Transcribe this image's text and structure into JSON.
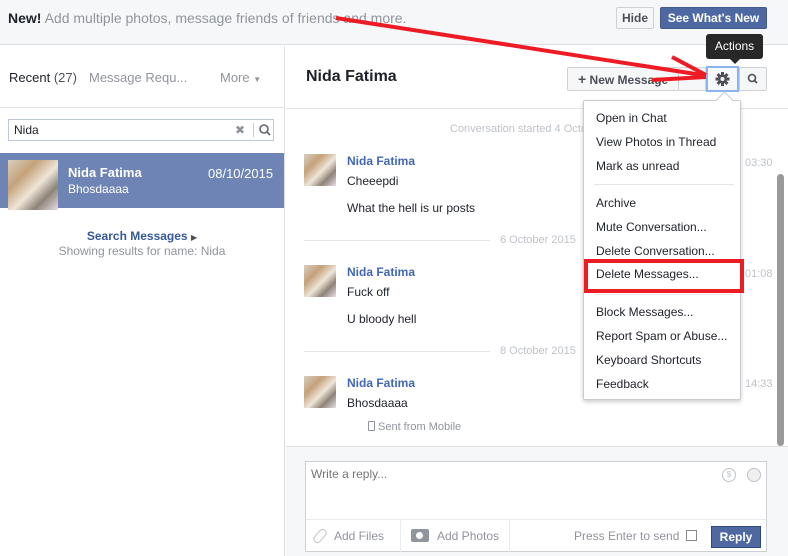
{
  "banner": {
    "new_label": "New!",
    "message": "Add multiple photos, message friends of friends and more.",
    "hide_label": "Hide",
    "see_whats_new_label": "See What's New"
  },
  "sidebar": {
    "recent_label": "Recent",
    "recent_count": "(27)",
    "requests_label": "Message Requ...",
    "more_label": "More",
    "search": {
      "value": "Nida",
      "placeholder": ""
    },
    "conversations": [
      {
        "name": "Nida Fatima",
        "snippet": "Bhosdaaaa",
        "date": "08/10/2015",
        "selected": true
      }
    ],
    "search_messages_label": "Search Messages",
    "showing_results": "Showing results for name: Nida"
  },
  "header": {
    "title": "Nida Fatima",
    "new_message_label": "New Message",
    "tooltip": "Actions"
  },
  "actions_menu": {
    "items": [
      "Open in Chat",
      "View Photos in Thread",
      "Mark as unread",
      "Archive",
      "Mute Conversation...",
      "Delete Conversation...",
      "Delete Messages...",
      "Block Messages...",
      "Report Spam or Abuse...",
      "Keyboard Shortcuts",
      "Feedback"
    ],
    "highlighted": "Delete Messages..."
  },
  "thread": {
    "started_label": "Conversation started 4 Octo",
    "groups": [
      {
        "day": "",
        "sender": "Nida Fatima",
        "lines": [
          "Cheeepdi",
          "What the hell is ur posts"
        ],
        "time": "03:30"
      },
      {
        "day": "6 October 2015",
        "sender": "Nida Fatima",
        "lines": [
          "Fuck off",
          "U bloody hell"
        ],
        "time": "01:08"
      },
      {
        "day": "8 October 2015",
        "sender": "Nida Fatima",
        "lines": [
          "Bhosdaaaa"
        ],
        "time": "14:33"
      }
    ],
    "sent_from": "Sent from Mobile"
  },
  "composer": {
    "placeholder": "Write a reply...",
    "add_files_label": "Add Files",
    "add_photos_label": "Add Photos",
    "press_enter_label": "Press Enter to send",
    "reply_label": "Reply"
  },
  "colors": {
    "brand": "#4e69a2",
    "selected_row": "#6d84b4",
    "annotation": "#ed1c24"
  }
}
